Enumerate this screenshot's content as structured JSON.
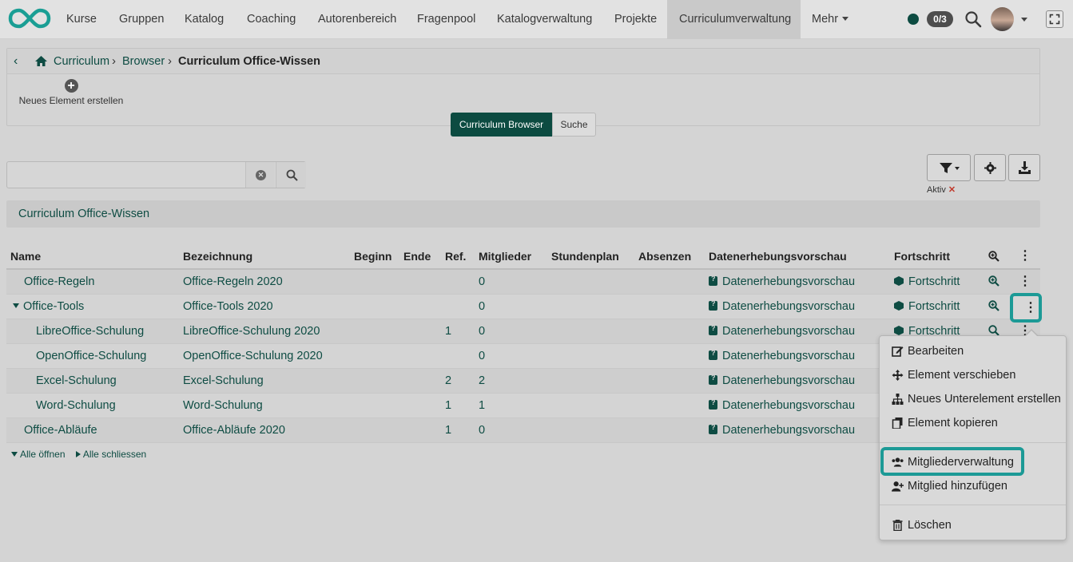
{
  "nav": {
    "items": [
      "Kurse",
      "Gruppen",
      "Katalog",
      "Coaching",
      "Autorenbereich",
      "Fragenpool",
      "Katalogverwaltung",
      "Projekte",
      "Curriculumverwaltung",
      "Mehr"
    ],
    "badge": "0/3"
  },
  "breadcrumb": {
    "items": [
      "Curriculum",
      "Browser"
    ],
    "current": "Curriculum Office-Wissen"
  },
  "new_element_label": "Neues Element erstellen",
  "segmented": {
    "browser": "Curriculum Browser",
    "search": "Suche"
  },
  "search": {
    "value": ""
  },
  "filter_state": {
    "label": "Aktiv",
    "remove": "✕"
  },
  "group_title": "Curriculum Office-Wissen",
  "table": {
    "headers": {
      "name": "Name",
      "bezeichnung": "Bezeichnung",
      "beginn": "Beginn",
      "ende": "Ende",
      "ref": "Ref.",
      "mitglieder": "Mitglieder",
      "stundenplan": "Stundenplan",
      "absenzen": "Absenzen",
      "datenerhebung": "Datenerhebungsvorschau",
      "fortschritt": "Fortschritt"
    },
    "rows": [
      {
        "name": "Office-Regeln",
        "bezeichnung": "Office-Regeln 2020",
        "ref": "",
        "mitglieder": "0",
        "daten": "Datenerhebungsvorschau",
        "fortschritt": "Fortschritt"
      },
      {
        "name": "Office-Tools",
        "bezeichnung": "Office-Tools 2020",
        "ref": "",
        "mitglieder": "0",
        "daten": "Datenerhebungsvorschau",
        "fortschritt": "Fortschritt"
      },
      {
        "name": "LibreOffice-Schulung",
        "bezeichnung": "LibreOffice-Schulung 2020",
        "ref": "1",
        "mitglieder": "0",
        "daten": "Datenerhebungsvorschau",
        "fortschritt": "Fortschritt"
      },
      {
        "name": "OpenOffice-Schulung",
        "bezeichnung": "OpenOffice-Schulung 2020",
        "ref": "",
        "mitglieder": "0",
        "daten": "Datenerhebungsvorschau",
        "fortschritt": ""
      },
      {
        "name": "Excel-Schulung",
        "bezeichnung": "Excel-Schulung",
        "ref": "2",
        "mitglieder": "2",
        "daten": "Datenerhebungsvorschau",
        "fortschritt": ""
      },
      {
        "name": "Word-Schulung",
        "bezeichnung": "Word-Schulung",
        "ref": "1",
        "mitglieder": "1",
        "daten": "Datenerhebungsvorschau",
        "fortschritt": ""
      },
      {
        "name": "Office-Abläufe",
        "bezeichnung": "Office-Abläufe 2020",
        "ref": "1",
        "mitglieder": "0",
        "daten": "Datenerhebungsvorschau",
        "fortschritt": ""
      }
    ]
  },
  "tree_links": {
    "open_all": "Alle öffnen",
    "close_all": "Alle schliessen"
  },
  "context_menu": {
    "edit": "Bearbeiten",
    "move": "Element verschieben",
    "new_sub": "Neues Unterelement erstellen",
    "copy": "Element kopieren",
    "members": "Mitgliederverwaltung",
    "add_member": "Mitglied hinzufügen",
    "delete": "Löschen"
  },
  "colors": {
    "accent": "#0c4b41",
    "highlight": "#1c9a96",
    "logo": "#1a9e94"
  }
}
